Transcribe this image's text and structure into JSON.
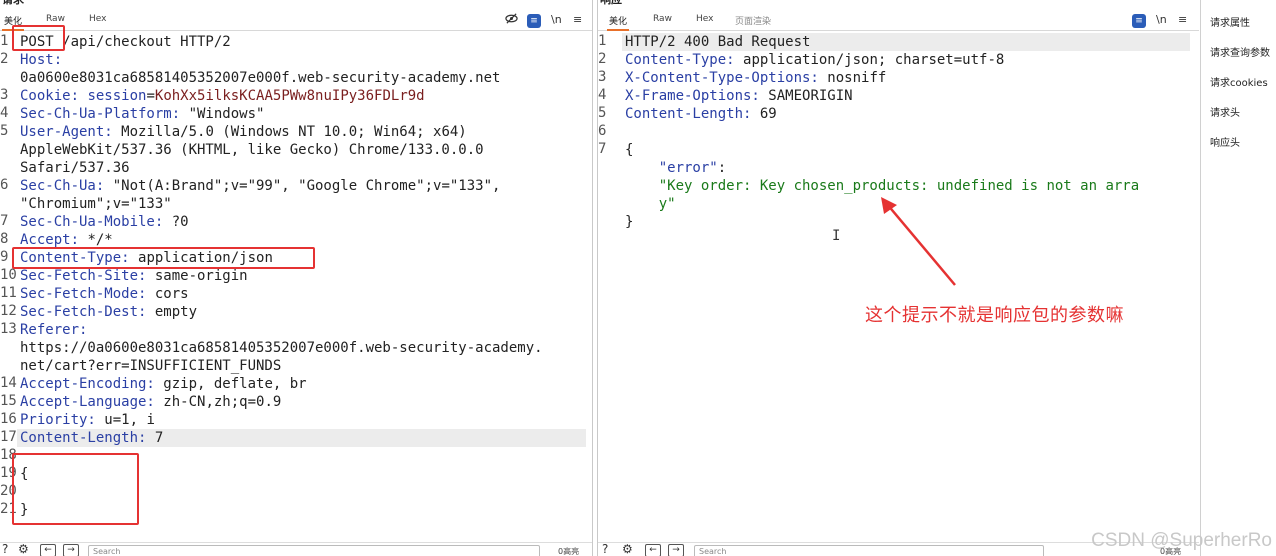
{
  "request": {
    "title": "请求",
    "tabs": [
      "美化",
      "Raw",
      "Hex"
    ],
    "toolbar": {
      "wrap": "\\n",
      "menu": "≡"
    },
    "lines": [
      {
        "n": "1",
        "parts": [
          [
            "v",
            "POST /api/checkout HTTP/2"
          ]
        ]
      },
      {
        "n": "2",
        "parts": [
          [
            "k",
            "Host:"
          ]
        ]
      },
      {
        "n": "",
        "parts": [
          [
            "v",
            "0a0600e8031ca68581405352007e000f.web-security-academy.net"
          ]
        ]
      },
      {
        "n": "3",
        "parts": [
          [
            "k",
            "Cookie: "
          ],
          [
            "k",
            "session"
          ],
          [
            "v",
            "="
          ],
          [
            "ck",
            "KohXx5ilksKCAA5PWw8nuIPy36FDLr9d"
          ]
        ]
      },
      {
        "n": "4",
        "parts": [
          [
            "k",
            "Sec-Ch-Ua-Platform: "
          ],
          [
            "v",
            "\"Windows\""
          ]
        ]
      },
      {
        "n": "5",
        "parts": [
          [
            "k",
            "User-Agent: "
          ],
          [
            "v",
            "Mozilla/5.0 (Windows NT 10.0; Win64; x64)"
          ]
        ]
      },
      {
        "n": "",
        "parts": [
          [
            "v",
            "AppleWebKit/537.36 (KHTML, like Gecko) Chrome/133.0.0.0"
          ]
        ]
      },
      {
        "n": "",
        "parts": [
          [
            "v",
            "Safari/537.36"
          ]
        ]
      },
      {
        "n": "6",
        "parts": [
          [
            "k",
            "Sec-Ch-Ua: "
          ],
          [
            "v",
            "\"Not(A:Brand\";v=\"99\", \"Google Chrome\";v=\"133\","
          ]
        ]
      },
      {
        "n": "",
        "parts": [
          [
            "v",
            "\"Chromium\";v=\"133\""
          ]
        ]
      },
      {
        "n": "7",
        "parts": [
          [
            "k",
            "Sec-Ch-Ua-Mobile: "
          ],
          [
            "v",
            "?0"
          ]
        ]
      },
      {
        "n": "8",
        "parts": [
          [
            "k",
            "Accept: "
          ],
          [
            "v",
            "*/*"
          ]
        ]
      },
      {
        "n": "9",
        "parts": [
          [
            "k",
            "Content-Type: "
          ],
          [
            "v",
            "application/json"
          ]
        ]
      },
      {
        "n": "10",
        "parts": [
          [
            "k",
            "Sec-Fetch-Site: "
          ],
          [
            "v",
            "same-origin"
          ]
        ]
      },
      {
        "n": "11",
        "parts": [
          [
            "k",
            "Sec-Fetch-Mode: "
          ],
          [
            "v",
            "cors"
          ]
        ]
      },
      {
        "n": "12",
        "parts": [
          [
            "k",
            "Sec-Fetch-Dest: "
          ],
          [
            "v",
            "empty"
          ]
        ]
      },
      {
        "n": "13",
        "parts": [
          [
            "k",
            "Referer:"
          ]
        ]
      },
      {
        "n": "",
        "parts": [
          [
            "v",
            "https://0a0600e8031ca68581405352007e000f.web-security-academy."
          ]
        ]
      },
      {
        "n": "",
        "parts": [
          [
            "v",
            "net/cart?err=INSUFFICIENT_FUNDS"
          ]
        ]
      },
      {
        "n": "14",
        "parts": [
          [
            "k",
            "Accept-Encoding: "
          ],
          [
            "v",
            "gzip, deflate, br"
          ]
        ]
      },
      {
        "n": "15",
        "parts": [
          [
            "k",
            "Accept-Language: "
          ],
          [
            "v",
            "zh-CN,zh;q=0.9"
          ]
        ]
      },
      {
        "n": "16",
        "parts": [
          [
            "k",
            "Priority: "
          ],
          [
            "v",
            "u=1, i"
          ]
        ]
      },
      {
        "n": "17",
        "parts": [
          [
            "k",
            "Content-Length: "
          ],
          [
            "v",
            "7"
          ]
        ]
      },
      {
        "n": "18",
        "parts": [
          [
            "v",
            ""
          ]
        ]
      },
      {
        "n": "19",
        "parts": [
          [
            "v",
            "{"
          ]
        ]
      },
      {
        "n": "20",
        "parts": [
          [
            "v",
            ""
          ]
        ]
      },
      {
        "n": "21",
        "parts": [
          [
            "v",
            "}"
          ]
        ]
      }
    ],
    "search_placeholder": "Search",
    "hits": "0高亮"
  },
  "response": {
    "title": "响应",
    "tabs": [
      "美化",
      "Raw",
      "Hex",
      "页面渲染"
    ],
    "toolbar": {
      "wrap": "\\n",
      "menu": "≡"
    },
    "lines": [
      {
        "n": "1",
        "parts": [
          [
            "v",
            "HTTP/2 400 Bad Request"
          ]
        ]
      },
      {
        "n": "2",
        "parts": [
          [
            "k",
            "Content-Type: "
          ],
          [
            "v",
            "application/json; charset=utf-8"
          ]
        ]
      },
      {
        "n": "3",
        "parts": [
          [
            "k",
            "X-Content-Type-Options: "
          ],
          [
            "v",
            "nosniff"
          ]
        ]
      },
      {
        "n": "4",
        "parts": [
          [
            "k",
            "X-Frame-Options: "
          ],
          [
            "v",
            "SAMEORIGIN"
          ]
        ]
      },
      {
        "n": "5",
        "parts": [
          [
            "k",
            "Content-Length: "
          ],
          [
            "v",
            "69"
          ]
        ]
      },
      {
        "n": "6",
        "parts": [
          [
            "v",
            ""
          ]
        ]
      },
      {
        "n": "7",
        "parts": [
          [
            "v",
            "{"
          ]
        ]
      },
      {
        "n": "",
        "parts": [
          [
            "v",
            "    "
          ],
          [
            "k",
            "\"error\""
          ],
          [
            "v",
            ":"
          ]
        ]
      },
      {
        "n": "",
        "parts": [
          [
            "v",
            "    "
          ],
          [
            "s",
            "\"Key order: Key chosen_products: undefined is not an arra"
          ]
        ]
      },
      {
        "n": "",
        "parts": [
          [
            "v",
            "    "
          ],
          [
            "s",
            "y\""
          ]
        ]
      },
      {
        "n": "",
        "parts": [
          [
            "v",
            "}"
          ]
        ]
      }
    ],
    "search_placeholder": "Search",
    "hits": "0高亮"
  },
  "inspector": {
    "items": [
      "请求属性",
      "请求查询参数",
      "请求cookies",
      "请求头",
      "响应头"
    ]
  },
  "annotation": "这个提示不就是响应包的参数嘛",
  "watermark": "CSDN @SuperherRo",
  "colors": {
    "highlight_box": "#e53232",
    "header_key": "#2a3fa4",
    "json_string": "#1a7a1a",
    "cookie_value": "#7a1f1f",
    "accent_tab": "#e8702a"
  }
}
